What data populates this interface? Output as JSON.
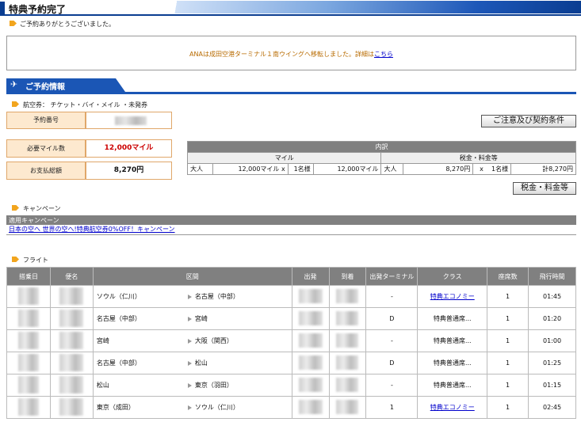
{
  "page_title": "特典予約完了",
  "thanks": "ご予約ありがとうございました。",
  "notice": {
    "text": "ANAは成田空港ターミナル１南ウイングへ移転しました。詳細は",
    "link": "こちら"
  },
  "section_title": "ご予約情報",
  "ticket_line": "航空券： チケット・バイ・メイル ・未発券",
  "booking": {
    "number_label": "予約番号",
    "miles_label": "必要マイル数",
    "miles_value": "12,000マイル",
    "payment_label": "お支払総額",
    "payment_value": "8,270円"
  },
  "buttons": {
    "terms": "ご注意及び契約条件",
    "taxes": "税金・料金等"
  },
  "breakdown": {
    "header": "内訳",
    "col_miles": "マイル",
    "col_taxes": "税金・料金等",
    "row": {
      "type": "大人",
      "miles_each": "12,000マイル x",
      "count1": "1名様",
      "miles_total": "12,000マイル",
      "type2": "大人",
      "tax_each": "8,270円",
      "x": "x",
      "count2": "1名様",
      "tax_total": "計8,270円"
    }
  },
  "campaign": {
    "heading": "キャンペーン",
    "table_header": "適用キャンペーン",
    "link": "日本の空へ 世界の空へ!特典航空券0%OFF！キャンペーン"
  },
  "flight": {
    "heading": "フライト",
    "columns": [
      "搭乗日",
      "便名",
      "区間",
      "出発",
      "到着",
      "出発ターミナル",
      "クラス",
      "座席数",
      "飛行時間"
    ],
    "rows": [
      {
        "from": "ソウル（仁川）",
        "to": "名古屋（中部）",
        "terminal": "-",
        "class": "特典エコノミー",
        "class_link": true,
        "seats": "1",
        "duration": "01:45"
      },
      {
        "from": "名古屋（中部）",
        "to": "宮崎",
        "terminal": "D",
        "class": "特典普通席...",
        "class_link": false,
        "seats": "1",
        "duration": "01:20"
      },
      {
        "from": "宮崎",
        "to": "大阪（関西）",
        "terminal": "-",
        "class": "特典普通席...",
        "class_link": false,
        "seats": "1",
        "duration": "01:00"
      },
      {
        "from": "名古屋（中部）",
        "to": "松山",
        "terminal": "D",
        "class": "特典普通席...",
        "class_link": false,
        "seats": "1",
        "duration": "01:25"
      },
      {
        "from": "松山",
        "to": "東京（羽田）",
        "terminal": "-",
        "class": "特典普通席...",
        "class_link": false,
        "seats": "1",
        "duration": "01:15"
      },
      {
        "from": "東京（成田）",
        "to": "ソウル（仁川）",
        "terminal": "1",
        "class": "特典エコノミー",
        "class_link": true,
        "seats": "1",
        "duration": "02:45"
      }
    ]
  }
}
